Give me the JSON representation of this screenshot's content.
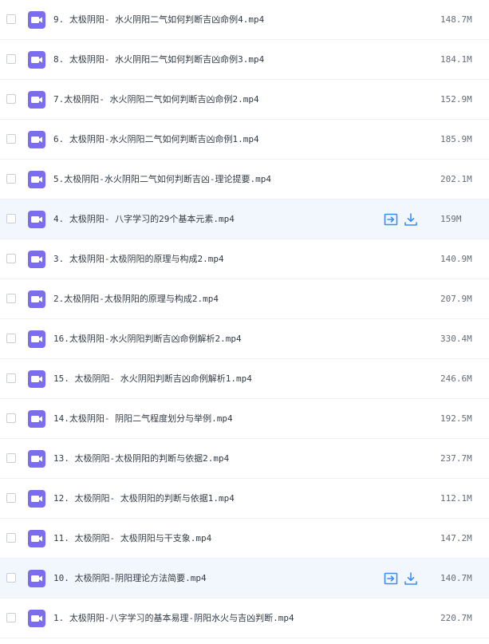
{
  "colors": {
    "accent": "#3b8cf7",
    "video_icon": "#7b6cf0",
    "row_hover_bg": "#f2f7fd"
  },
  "icons": {
    "file": "video-file-icon",
    "share": "share-icon",
    "download": "download-icon"
  },
  "files": [
    {
      "name": "9. 太极阴阳- 水火阴阳二气如何判断吉凶命例4.mp4",
      "size": "148.7M",
      "hover": false
    },
    {
      "name": "8. 太极阴阳- 水火阴阳二气如何判断吉凶命例3.mp4",
      "size": "184.1M",
      "hover": false
    },
    {
      "name": "7.太极阴阳- 水火阴阳二气如何判断吉凶命例2.mp4",
      "size": "152.9M",
      "hover": false
    },
    {
      "name": "6. 太极阴阳-水火阴阳二气如何判断吉凶命例1.mp4",
      "size": "185.9M",
      "hover": false
    },
    {
      "name": "5.太极阴阳-水火阴阳二气如何判断吉凶-理论提要.mp4",
      "size": "202.1M",
      "hover": false
    },
    {
      "name": "4. 太极阴阳- 八字学习的29个基本元素.mp4",
      "size": "159M",
      "hover": true
    },
    {
      "name": "3. 太极阴阳-太极阴阳的原理与构成2.mp4",
      "size": "140.9M",
      "hover": false
    },
    {
      "name": "2.太极阴阳-太极阴阳的原理与构成2.mp4",
      "size": "207.9M",
      "hover": false
    },
    {
      "name": "16.太极阴阳-水火阴阳判断吉凶命例解析2.mp4",
      "size": "330.4M",
      "hover": false
    },
    {
      "name": "15. 太极阴阳- 水火阴阳判断吉凶命例解析1.mp4",
      "size": "246.6M",
      "hover": false
    },
    {
      "name": "14.太极阴阳- 阴阳二气程度划分与举例.mp4",
      "size": "192.5M",
      "hover": false
    },
    {
      "name": "13. 太极阴阳-太极阴阳的判断与依据2.mp4",
      "size": "237.7M",
      "hover": false
    },
    {
      "name": "12. 太极阴阳- 太极阴阳的判断与依据1.mp4",
      "size": "112.1M",
      "hover": false
    },
    {
      "name": "11. 太极阴阳- 太极阴阳与干支象.mp4",
      "size": "147.2M",
      "hover": false
    },
    {
      "name": "10. 太极阴阳-阴阳理论方法简要.mp4",
      "size": "140.7M",
      "hover": true
    },
    {
      "name": "1. 太极阴阳-八字学习的基本易理-阴阳水火与吉凶判断.mp4",
      "size": "220.7M",
      "hover": false
    }
  ]
}
